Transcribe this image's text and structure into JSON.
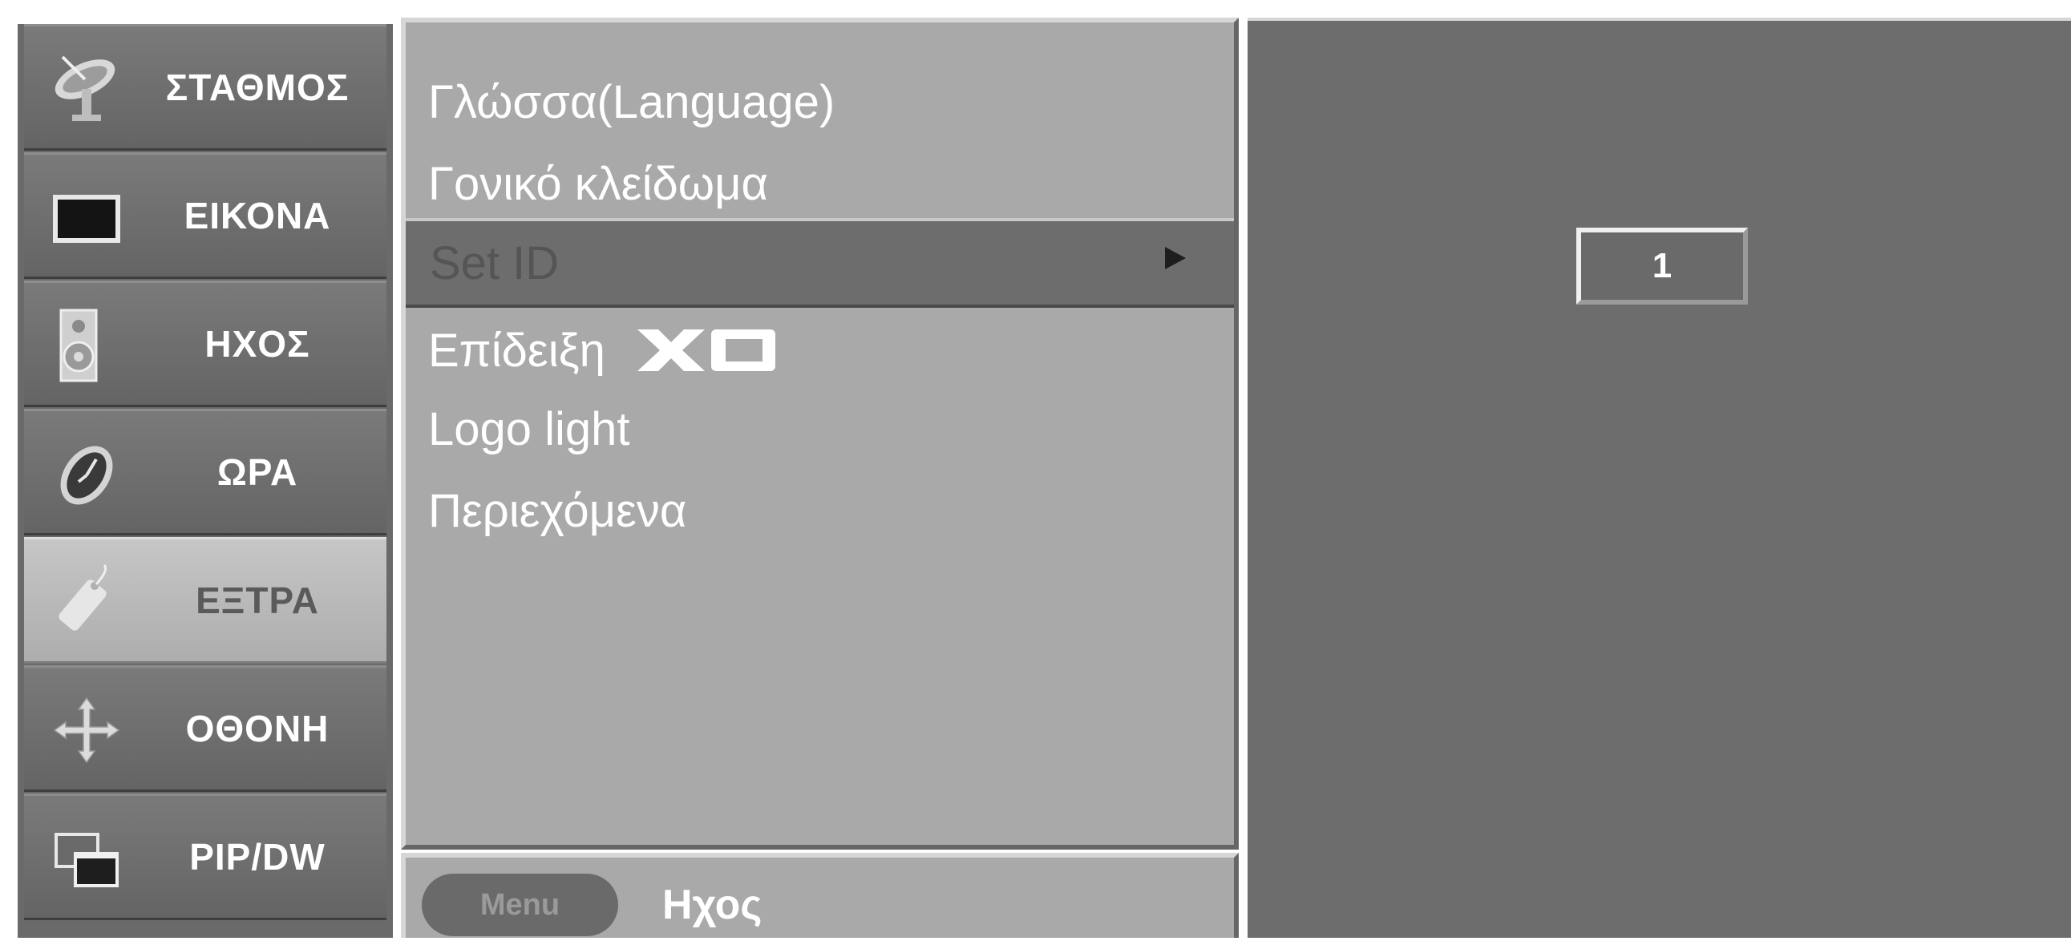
{
  "sidebar": {
    "items": [
      {
        "label": "ΣΤΑΘΜΟΣ",
        "icon": "satellite-dish-icon",
        "active": false
      },
      {
        "label": "ΕΙΚΟΝΑ",
        "icon": "tv-screen-icon",
        "active": false
      },
      {
        "label": "ΗΧΟΣ",
        "icon": "speaker-icon",
        "active": false
      },
      {
        "label": "ΩΡΑ",
        "icon": "clock-icon",
        "active": false
      },
      {
        "label": "ΕΞΤΡΑ",
        "icon": "remote-tag-icon",
        "active": true
      },
      {
        "label": "ΟΘΟΝΗ",
        "icon": "move-arrows-icon",
        "active": false
      },
      {
        "label": "PIP/DW",
        "icon": "picture-in-picture-icon",
        "active": false
      }
    ]
  },
  "menu": {
    "items": [
      {
        "label": "Γλώσσα(Language)"
      },
      {
        "label": "Γονικό κλείδωμα"
      },
      {
        "label": "Set ID",
        "selected": true
      },
      {
        "label": "Επίδειξη",
        "logo": "XD"
      },
      {
        "label": "Logo light"
      },
      {
        "label": "Περιεχόμενα"
      }
    ],
    "arrow_icon": "right-arrow-icon"
  },
  "bottom_bar": {
    "button_label": "Menu",
    "hint": "Ηχος"
  },
  "set_id": {
    "value": "1"
  },
  "colors": {
    "sidebar_bg": "#6a6a6a",
    "menu_bg": "#a9a9a9",
    "selected_bg": "#6d6d6d",
    "right_bg": "#6d6d6d",
    "text": "#ffffff"
  }
}
